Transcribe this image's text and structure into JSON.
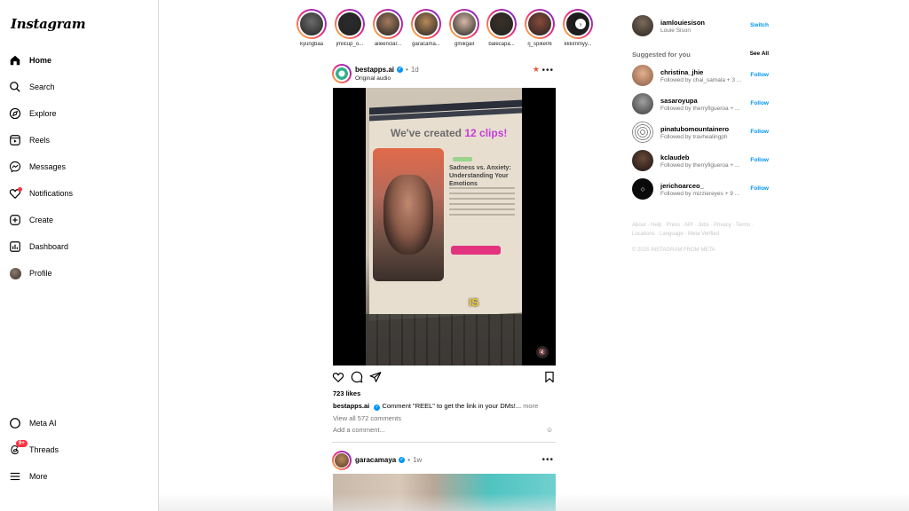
{
  "app": {
    "logo": "Instagram"
  },
  "nav": {
    "home": "Home",
    "search": "Search",
    "explore": "Explore",
    "reels": "Reels",
    "messages": "Messages",
    "notifications": "Notifications",
    "create": "Create",
    "dashboard": "Dashboard",
    "profile": "Profile",
    "meta_ai": "Meta AI",
    "threads": "Threads",
    "threads_badge": "9+",
    "more": "More"
  },
  "stories": [
    {
      "name": "kyungbaa",
      "color": "#6b6b6b"
    },
    {
      "name": "jmilcup_o...",
      "color": "#2b2b2b"
    },
    {
      "name": "aileenclar...",
      "color": "#a57b5e"
    },
    {
      "name": "garacama...",
      "color": "#b88a5a"
    },
    {
      "name": "gmikgail",
      "color": "#d8b9a8"
    },
    {
      "name": "balecapa...",
      "color": "#3a3028"
    },
    {
      "name": "rj_spike06",
      "color": "#8a4a3a"
    },
    {
      "name": "kkkimmyy...",
      "color": "#1a1a1a"
    }
  ],
  "post1": {
    "user": "bestapps.ai",
    "time": "1d",
    "audio": "Original audio",
    "video": {
      "headline_pre": "We've created ",
      "headline_hl": "12 clips!",
      "card_title": "Sadness vs. Anxiety: Understanding Your Emotions",
      "caption_word": "IS"
    },
    "likes": "723 likes",
    "caption_user": "bestapps.ai",
    "caption_text": "Comment \"REEL\" to get the link in your DMs!...",
    "caption_more": "more",
    "view_comments": "View all 572 comments",
    "add_comment_placeholder": "Add a comment..."
  },
  "post2": {
    "user": "garacamaya",
    "time": "1w"
  },
  "account": {
    "username": "iamlouiesison",
    "fullname": "Louie Sison",
    "switch": "Switch"
  },
  "suggestions": {
    "title": "Suggested for you",
    "see_all": "See All",
    "follow_label": "Follow",
    "items": [
      {
        "name": "christina_jhie",
        "sub": "Followed by chai_samala + 3 ...",
        "color": "#c88a6a"
      },
      {
        "name": "sasaroyupa",
        "sub": "Followed by therryfigueroa + ...",
        "color": "#7a7a7a"
      },
      {
        "name": "pinatubomountainero",
        "sub": "Followed by travhealingph",
        "color": "#d8d8d8"
      },
      {
        "name": "kclaudeb",
        "sub": "Followed by therryfigueroa + ...",
        "color": "#3a2a22"
      },
      {
        "name": "jerichoarceo_",
        "sub": "Followed by mizziereyes + 9 ...",
        "color": "#0a0a0a"
      }
    ]
  },
  "footer": {
    "links": "About · Help · Press · API · Jobs · Privacy · Terms · Locations · Language · Meta Verified",
    "copyright": "© 2025 INSTAGRAM FROM META"
  }
}
